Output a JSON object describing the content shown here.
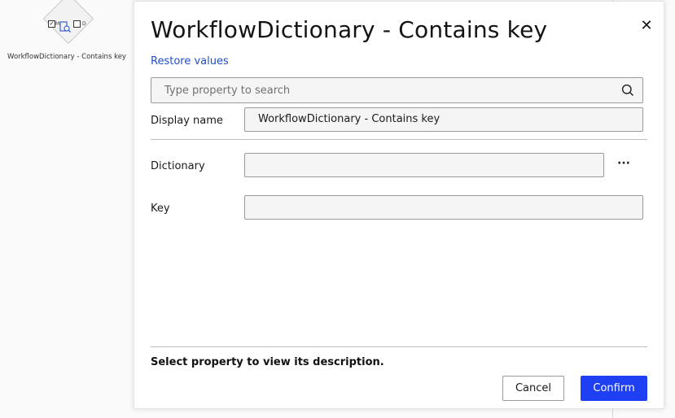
{
  "canvas": {
    "node": {
      "caption": "WorkflowDictionary - Contains key",
      "checkbox_left_label": "M",
      "checkbox_right_label": "D",
      "icon": "search-document-icon"
    }
  },
  "dialog": {
    "title": "WorkflowDictionary - Contains key",
    "close_icon": "close-icon",
    "restore_label": "Restore values",
    "search": {
      "placeholder": "Type property to search",
      "value": "",
      "icon": "search-icon"
    },
    "properties": {
      "display_name": {
        "label": "Display name",
        "value": "WorkflowDictionary - Contains key"
      },
      "dictionary": {
        "label": "Dictionary",
        "value": "",
        "more_label": "···"
      },
      "key": {
        "label": "Key",
        "value": ""
      }
    },
    "description": "Select property to view its description.",
    "cancel_label": "Cancel",
    "confirm_label": "Confirm",
    "colors": {
      "accent": "#1f3ff2",
      "link": "#1f4fc9"
    }
  }
}
